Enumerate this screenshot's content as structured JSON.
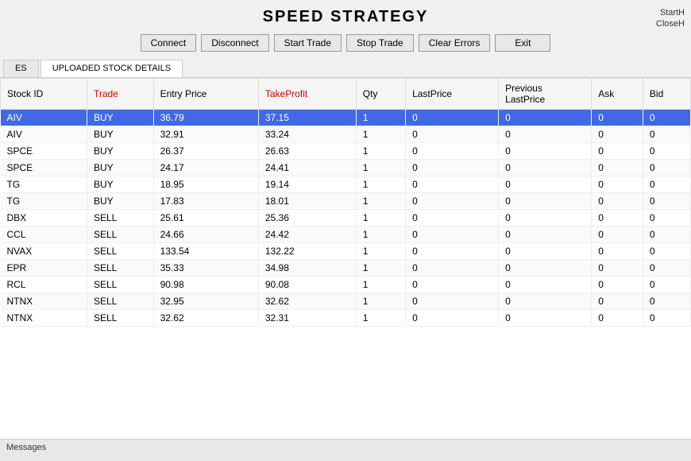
{
  "header": {
    "title": "SPEED STRATEGY"
  },
  "toolbar": {
    "buttons": [
      {
        "id": "connect",
        "label": "Connect"
      },
      {
        "id": "disconnect",
        "label": "Disconnect"
      },
      {
        "id": "start-trade",
        "label": "Start Trade"
      },
      {
        "id": "stop-trade",
        "label": "Stop Trade"
      },
      {
        "id": "clear-errors",
        "label": "Clear Errors"
      },
      {
        "id": "exit",
        "label": "Exit"
      }
    ]
  },
  "side_labels": [
    {
      "id": "start-h",
      "label": "StartH"
    },
    {
      "id": "close-h",
      "label": "CloseH"
    }
  ],
  "tabs": [
    {
      "id": "tab-es",
      "label": "ES",
      "active": false
    },
    {
      "id": "tab-uploaded",
      "label": "UPLOADED STOCK DETAILS",
      "active": true
    }
  ],
  "table": {
    "columns": [
      {
        "id": "stock-id",
        "label": "Stock ID",
        "color": "black"
      },
      {
        "id": "trade",
        "label": "Trade",
        "color": "red"
      },
      {
        "id": "entry-price",
        "label": "Entry Price",
        "color": "black"
      },
      {
        "id": "take-profit",
        "label": "TakeProfit",
        "color": "red"
      },
      {
        "id": "qty",
        "label": "Qty",
        "color": "black"
      },
      {
        "id": "last-price",
        "label": "LastPrice",
        "color": "black"
      },
      {
        "id": "prev-last-price",
        "label": "Previous\nLastPrice",
        "color": "black"
      },
      {
        "id": "ask",
        "label": "Ask",
        "color": "black"
      },
      {
        "id": "bid",
        "label": "Bid",
        "color": "black"
      }
    ],
    "rows": [
      {
        "stock_id": "AIV",
        "trade": "BUY",
        "entry_price": "36.79",
        "take_profit": "37.15",
        "qty": "1",
        "last_price": "0",
        "prev_last_price": "0",
        "ask": "0",
        "bid": "0",
        "selected": true
      },
      {
        "stock_id": "AIV",
        "trade": "BUY",
        "entry_price": "32.91",
        "take_profit": "33.24",
        "qty": "1",
        "last_price": "0",
        "prev_last_price": "0",
        "ask": "0",
        "bid": "0",
        "selected": false
      },
      {
        "stock_id": "SPCE",
        "trade": "BUY",
        "entry_price": "26.37",
        "take_profit": "26.63",
        "qty": "1",
        "last_price": "0",
        "prev_last_price": "0",
        "ask": "0",
        "bid": "0",
        "selected": false
      },
      {
        "stock_id": "SPCE",
        "trade": "BUY",
        "entry_price": "24.17",
        "take_profit": "24.41",
        "qty": "1",
        "last_price": "0",
        "prev_last_price": "0",
        "ask": "0",
        "bid": "0",
        "selected": false
      },
      {
        "stock_id": "TG",
        "trade": "BUY",
        "entry_price": "18.95",
        "take_profit": "19.14",
        "qty": "1",
        "last_price": "0",
        "prev_last_price": "0",
        "ask": "0",
        "bid": "0",
        "selected": false
      },
      {
        "stock_id": "TG",
        "trade": "BUY",
        "entry_price": "17.83",
        "take_profit": "18.01",
        "qty": "1",
        "last_price": "0",
        "prev_last_price": "0",
        "ask": "0",
        "bid": "0",
        "selected": false
      },
      {
        "stock_id": "DBX",
        "trade": "SELL",
        "entry_price": "25.61",
        "take_profit": "25.36",
        "qty": "1",
        "last_price": "0",
        "prev_last_price": "0",
        "ask": "0",
        "bid": "0",
        "selected": false
      },
      {
        "stock_id": "CCL",
        "trade": "SELL",
        "entry_price": "24.66",
        "take_profit": "24.42",
        "qty": "1",
        "last_price": "0",
        "prev_last_price": "0",
        "ask": "0",
        "bid": "0",
        "selected": false
      },
      {
        "stock_id": "NVAX",
        "trade": "SELL",
        "entry_price": "133.54",
        "take_profit": "132.22",
        "qty": "1",
        "last_price": "0",
        "prev_last_price": "0",
        "ask": "0",
        "bid": "0",
        "selected": false
      },
      {
        "stock_id": "EPR",
        "trade": "SELL",
        "entry_price": "35.33",
        "take_profit": "34.98",
        "qty": "1",
        "last_price": "0",
        "prev_last_price": "0",
        "ask": "0",
        "bid": "0",
        "selected": false
      },
      {
        "stock_id": "RCL",
        "trade": "SELL",
        "entry_price": "90.98",
        "take_profit": "90.08",
        "qty": "1",
        "last_price": "0",
        "prev_last_price": "0",
        "ask": "0",
        "bid": "0",
        "selected": false
      },
      {
        "stock_id": "NTNX",
        "trade": "SELL",
        "entry_price": "32.95",
        "take_profit": "32.62",
        "qty": "1",
        "last_price": "0",
        "prev_last_price": "0",
        "ask": "0",
        "bid": "0",
        "selected": false
      },
      {
        "stock_id": "NTNX",
        "trade": "SELL",
        "entry_price": "32.62",
        "take_profit": "32.31",
        "qty": "1",
        "last_price": "0",
        "prev_last_price": "0",
        "ask": "0",
        "bid": "0",
        "selected": false
      }
    ]
  },
  "messages_bar": {
    "label": "Messages"
  }
}
